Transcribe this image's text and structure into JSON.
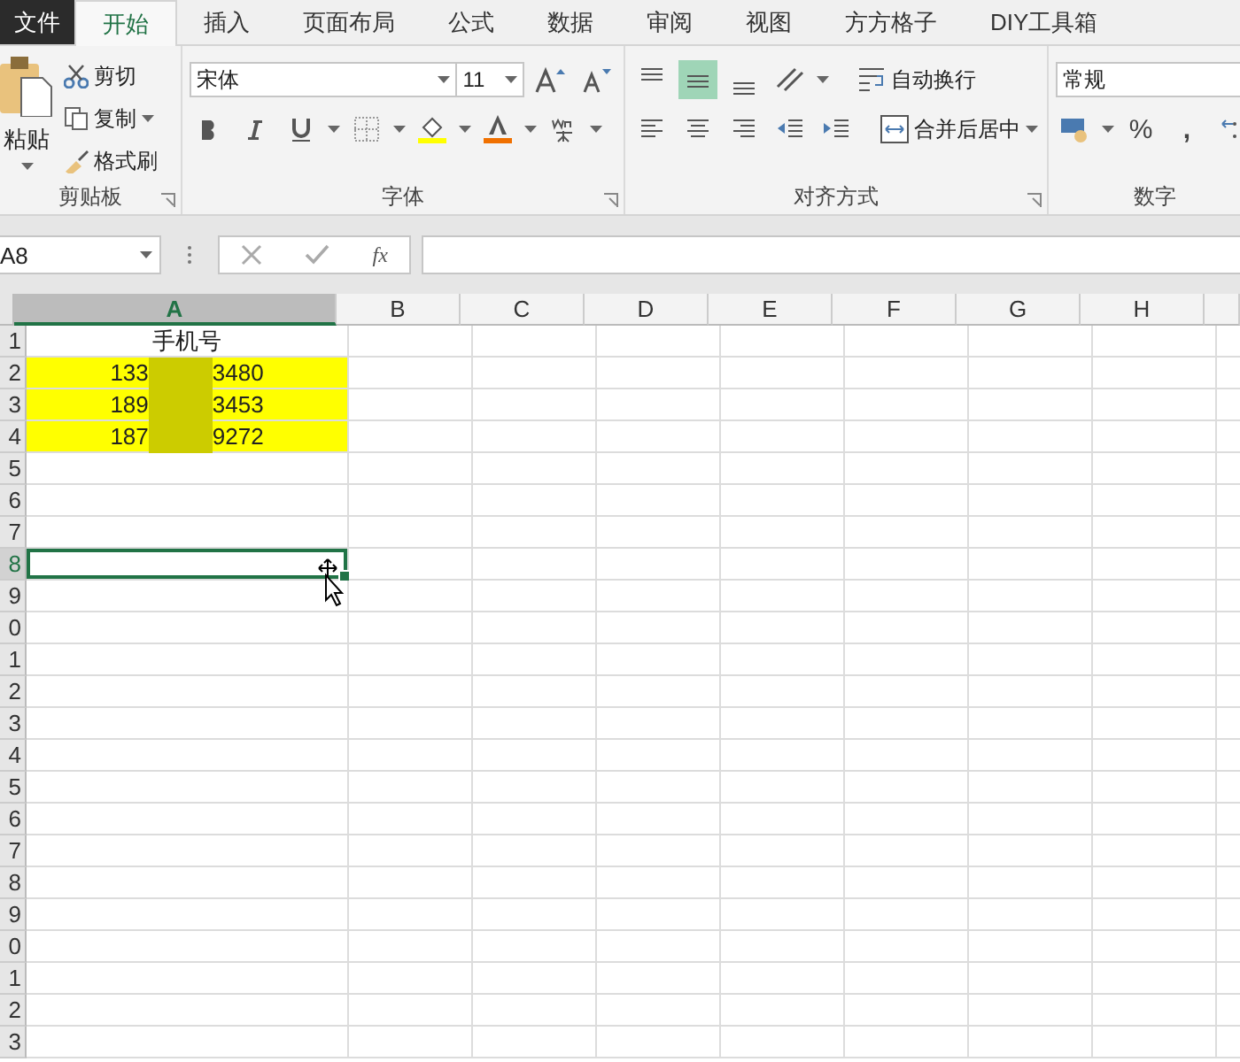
{
  "tabs": [
    {
      "label": "文件",
      "kind": "file",
      "selected": false
    },
    {
      "label": "开始",
      "kind": "tab",
      "selected": true
    },
    {
      "label": "插入",
      "kind": "tab",
      "selected": false
    },
    {
      "label": "页面布局",
      "kind": "tab",
      "selected": false
    },
    {
      "label": "公式",
      "kind": "tab",
      "selected": false
    },
    {
      "label": "数据",
      "kind": "tab",
      "selected": false
    },
    {
      "label": "审阅",
      "kind": "tab",
      "selected": false
    },
    {
      "label": "视图",
      "kind": "tab",
      "selected": false
    },
    {
      "label": "方方格子",
      "kind": "tab",
      "selected": false
    },
    {
      "label": "DIY工具箱",
      "kind": "tab",
      "selected": false
    }
  ],
  "ribbon": {
    "clipboard": {
      "paste": "粘贴",
      "cut": "剪切",
      "copy": "复制",
      "format_painter": "格式刷",
      "label": "剪贴板"
    },
    "font": {
      "font_name": "宋体",
      "font_size": "11",
      "label": "字体"
    },
    "alignment": {
      "vertical": [
        {
          "kind": "top",
          "selected": false
        },
        {
          "kind": "middle",
          "selected": true
        },
        {
          "kind": "bottom",
          "selected": false
        }
      ],
      "wrap_text": "自动换行",
      "merge_center": "合并后居中",
      "label": "对齐方式"
    },
    "number": {
      "format": "常规",
      "percent": "%",
      "comma": ",",
      "label": "数字"
    }
  },
  "formula_bar": {
    "name_box": "A8",
    "fx": "fx"
  },
  "sheet": {
    "columns": [
      {
        "label": "A",
        "selected": true
      },
      {
        "label": "B",
        "selected": false
      },
      {
        "label": "C",
        "selected": false
      },
      {
        "label": "D",
        "selected": false
      },
      {
        "label": "E",
        "selected": false
      },
      {
        "label": "F",
        "selected": false
      },
      {
        "label": "G",
        "selected": false
      },
      {
        "label": "H",
        "selected": false
      }
    ],
    "rows": [
      {
        "header": "1",
        "selected": false,
        "cell": {
          "text": "手机号"
        }
      },
      {
        "header": "2",
        "selected": false,
        "cell": {
          "prefix": "133",
          "suffix": "3480",
          "color": "#ffff00"
        }
      },
      {
        "header": "3",
        "selected": false,
        "cell": {
          "prefix": "189",
          "suffix": "3453",
          "color": "#ffff00"
        }
      },
      {
        "header": "4",
        "selected": false,
        "cell": {
          "prefix": "187",
          "suffix": "9272",
          "color": "#ffff00"
        }
      },
      {
        "header": "5",
        "selected": false
      },
      {
        "header": "6",
        "selected": false
      },
      {
        "header": "7",
        "selected": false
      },
      {
        "header": "8",
        "selected": true,
        "cell": {
          "active": true
        }
      },
      {
        "header": "9",
        "selected": false
      },
      {
        "header": "0",
        "selected": false
      },
      {
        "header": "1",
        "selected": false
      },
      {
        "header": "2",
        "selected": false
      },
      {
        "header": "3",
        "selected": false
      },
      {
        "header": "4",
        "selected": false
      },
      {
        "header": "5",
        "selected": false
      },
      {
        "header": "6",
        "selected": false
      },
      {
        "header": "7",
        "selected": false
      },
      {
        "header": "8",
        "selected": false
      },
      {
        "header": "9",
        "selected": false
      },
      {
        "header": "0",
        "selected": false
      },
      {
        "header": "1",
        "selected": false
      },
      {
        "header": "2",
        "selected": false
      },
      {
        "header": "3",
        "selected": false
      }
    ]
  }
}
